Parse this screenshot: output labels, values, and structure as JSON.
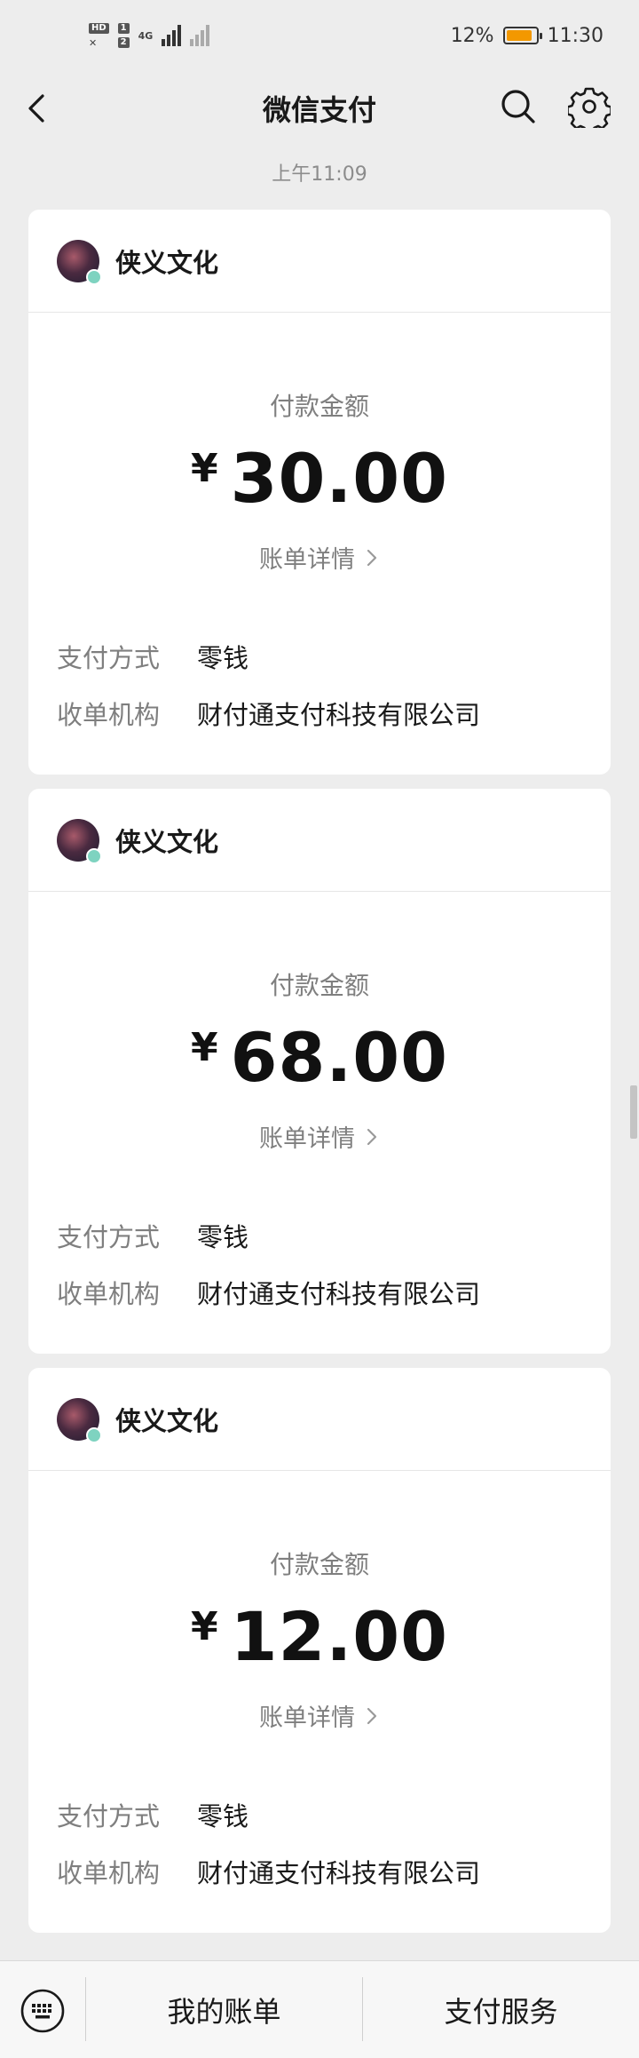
{
  "status_bar": {
    "hd_label": "HD",
    "sim1": "1",
    "network": "4G",
    "sim2": "2",
    "battery_percent": "12%",
    "time": "11:30"
  },
  "nav": {
    "title": "微信支付"
  },
  "timestamp": "上午11:09",
  "common": {
    "amount_label": "付款金额",
    "currency": "¥",
    "bill_details": "账单详情",
    "payment_method_label": "支付方式",
    "payment_method_value": "零钱",
    "acquirer_label": "收单机构",
    "acquirer_value": "财付通支付科技有限公司"
  },
  "cards": [
    {
      "merchant": "侠义文化",
      "amount": "30.00"
    },
    {
      "merchant": "侠义文化",
      "amount": "68.00"
    },
    {
      "merchant": "侠义文化",
      "amount": "12.00"
    }
  ],
  "bottom_bar": {
    "my_bills": "我的账单",
    "pay_services": "支付服务"
  },
  "colors": {
    "background": "#ededed",
    "card": "#ffffff",
    "primary_text": "#191919",
    "secondary_text": "#7f7f7f"
  }
}
